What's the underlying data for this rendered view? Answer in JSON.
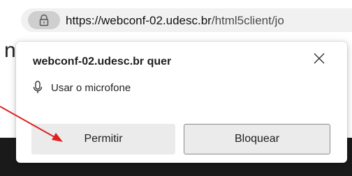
{
  "address_bar": {
    "url_host": "https://webconf-02.udesc.br",
    "url_path": "/html5client/jo"
  },
  "popup": {
    "title": "webconf-02.udesc.br quer",
    "permission": "Usar o microfone",
    "allow_label": "Permitir",
    "block_label": "Bloquear"
  },
  "annotation": {
    "arrow_color": "#e02020"
  },
  "icons": [
    "lock-icon",
    "close-icon",
    "microphone-icon"
  ]
}
